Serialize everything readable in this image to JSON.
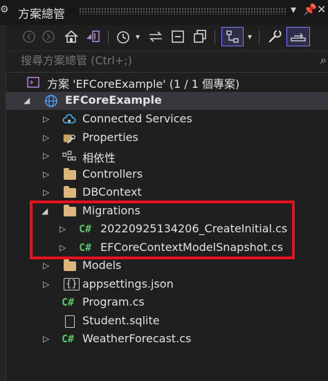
{
  "window": {
    "title": "方案總管",
    "pin_glyph": "📌",
    "close_glyph": "✕"
  },
  "toolbar": {
    "icons": [
      "back-icon",
      "forward-icon",
      "home-icon",
      "vs-solution-icon",
      "history-icon",
      "dropdown-icon",
      "sync-icon",
      "collapse-all-icon",
      "copy-icon",
      "show-all-files-icon",
      "dropdown-icon",
      "properties-wrench-icon",
      "preview-icon"
    ]
  },
  "search": {
    "placeholder": "搜尋方案總管 (Ctrl+;)"
  },
  "tree": {
    "solution": "方案 'EFCoreExample' (1 / 1 個專案)",
    "project": "EFCoreExample",
    "items": [
      {
        "label": "Connected Services",
        "icon": "connected-services-icon"
      },
      {
        "label": "Properties",
        "icon": "wrench-icon"
      },
      {
        "label": "相依性",
        "icon": "dependencies-icon"
      },
      {
        "label": "Controllers",
        "icon": "folder-icon"
      },
      {
        "label": "DBContext",
        "icon": "folder-icon"
      },
      {
        "label": "Migrations",
        "icon": "folder-icon"
      },
      {
        "label": "20220925134206_CreateInitial.cs",
        "icon": "csharp-icon"
      },
      {
        "label": "EFCoreContextModelSnapshot.cs",
        "icon": "csharp-icon"
      },
      {
        "label": "Models",
        "icon": "folder-icon"
      },
      {
        "label": "appsettings.json",
        "icon": "json-icon"
      },
      {
        "label": "Program.cs",
        "icon": "csharp-icon"
      },
      {
        "label": "Student.sqlite",
        "icon": "file-icon"
      },
      {
        "label": "WeatherForecast.cs",
        "icon": "csharp-icon"
      }
    ]
  },
  "colors": {
    "highlight": "#e8121f",
    "csharp": "#57c26a",
    "folder": "#dcb67a",
    "accent": "#7b7bff"
  }
}
